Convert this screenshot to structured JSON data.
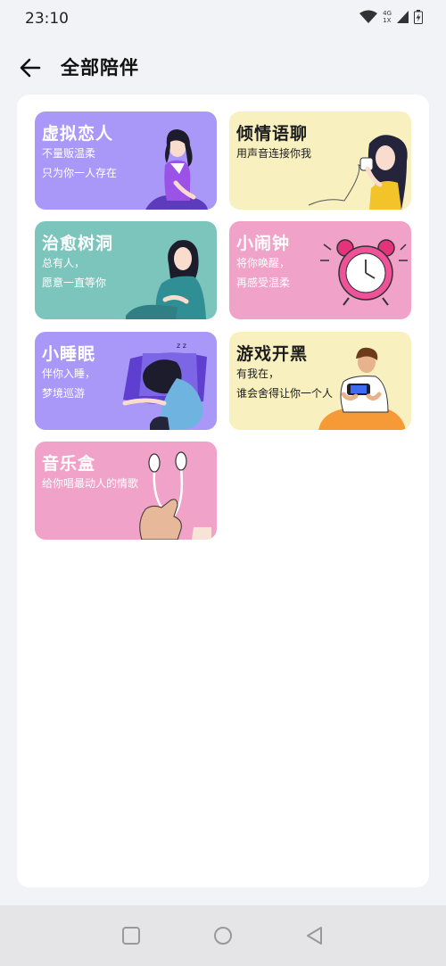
{
  "status_bar": {
    "time": "23:10",
    "network_top": "4G",
    "network_bottom": "1X",
    "icons": [
      "wifi-icon",
      "signal-icon",
      "battery-charging-icon"
    ]
  },
  "header": {
    "back_icon": "back-arrow-icon",
    "title": "全部陪伴"
  },
  "cards": [
    {
      "title": "虚拟恋人",
      "line1": "不量贩温柔",
      "line2": "只为你一人存在",
      "bg": "#a998f7",
      "icon": "girl-sitting-illustration"
    },
    {
      "title": "倾情语聊",
      "line1": "用声音连接你我",
      "line2": "",
      "bg": "#f8f0bf",
      "icon": "girl-tin-can-phone-illustration"
    },
    {
      "title": "治愈树洞",
      "line1": "总有人，",
      "line2": "愿意一直等你",
      "bg": "#7cc5bc",
      "icon": "girl-hugging-knees-illustration"
    },
    {
      "title": "小闹钟",
      "line1": "将你唤醒，",
      "line2": "再感受温柔",
      "bg": "#f1a2c9",
      "icon": "alarm-clock-illustration"
    },
    {
      "title": "小睡眠",
      "line1": "伴你入睡，",
      "line2": "梦境巡游",
      "bg": "#a998f7",
      "icon": "girl-sleeping-illustration"
    },
    {
      "title": "游戏开黑",
      "line1": "有我在，",
      "line2": "谁会舍得让你一个人",
      "bg": "#f8f0bf",
      "icon": "boy-gaming-illustration"
    },
    {
      "title": "音乐盒",
      "line1": "给你唱最动人的情歌",
      "line2": "",
      "bg": "#f1a2c9",
      "icon": "earphones-hand-illustration"
    }
  ],
  "nav_bar": {
    "icons": [
      "recent-apps-icon",
      "home-icon",
      "back-icon"
    ]
  }
}
